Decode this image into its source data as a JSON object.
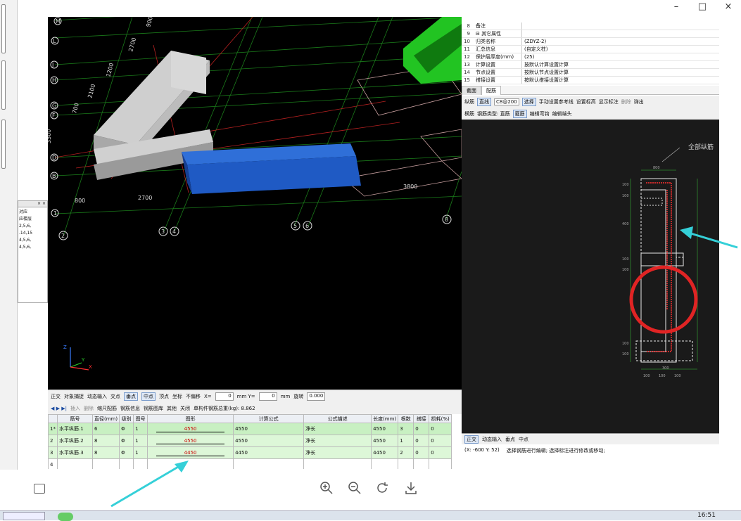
{
  "window": {
    "minimize": "–",
    "maximize": "□",
    "close": "×"
  },
  "leftPane": {
    "header": "× ×",
    "items": [
      "对应",
      "应楼层",
      "2,5,6,",
      ".14,15",
      "4,5,6,",
      "4,5,6,"
    ]
  },
  "viewport": {
    "axisLetters": [
      "M",
      "L",
      "K",
      "J",
      "H",
      "G",
      "F",
      "E",
      "D",
      "B"
    ],
    "axisNumbers": [
      "1",
      "2",
      "3",
      "4",
      "5",
      "6",
      "8"
    ],
    "dims": [
      "900",
      "2700",
      "1200",
      "2100",
      "700",
      "3500",
      "800",
      "2700",
      "3800",
      "6600"
    ],
    "triad": {
      "x": "X",
      "y": "Y",
      "z": "Z"
    }
  },
  "toolbar1": [
    "正交",
    "对象捕捉",
    "动态输入",
    "交点",
    "垂点",
    "中点",
    "顶点",
    "坐标",
    "不偏移",
    "X=",
    "mm Y=",
    "mm",
    "旋转"
  ],
  "toolbar1Values": {
    "x": "0",
    "y": "0",
    "rot": "0.000"
  },
  "toolbar2": [
    "插入",
    "删除",
    "缩尺配筋",
    "钢筋信息",
    "钢筋图库",
    "其他",
    "关闭",
    "单构件钢筋总重(kg): 8.862"
  ],
  "grid": {
    "headers": [
      "",
      "筋号",
      "直径(mm)",
      "级别",
      "图号",
      "图形",
      "计算公式",
      "公式描述",
      "长度(mm)",
      "根数",
      "搭接",
      "损耗(%)"
    ],
    "rows": [
      {
        "n": "1*",
        "name": "水平纵筋.1",
        "d": "6",
        "lv": "Φ",
        "fig": "1",
        "shape": "4550",
        "formula": "4550",
        "desc": "净长",
        "len": "4550",
        "cnt": "3",
        "lap": "0",
        "loss": "0"
      },
      {
        "n": "2",
        "name": "水平纵筋.2",
        "d": "8",
        "lv": "Φ",
        "fig": "1",
        "shape": "4550",
        "formula": "4550",
        "desc": "净长",
        "len": "4550",
        "cnt": "1",
        "lap": "0",
        "loss": "0"
      },
      {
        "n": "3",
        "name": "水平纵筋.3",
        "d": "8",
        "lv": "Φ",
        "fig": "1",
        "shape": "4450",
        "formula": "4450",
        "desc": "净长",
        "len": "4450",
        "cnt": "2",
        "lap": "0",
        "loss": "0"
      },
      {
        "n": "4",
        "name": "",
        "d": "",
        "lv": "",
        "fig": "",
        "shape": "",
        "formula": "",
        "desc": "",
        "len": "",
        "cnt": "",
        "lap": "",
        "loss": ""
      }
    ]
  },
  "props": [
    {
      "n": "8",
      "k": "备注",
      "v": ""
    },
    {
      "n": "9",
      "k": "⊟ 其它属性",
      "v": ""
    },
    {
      "n": "10",
      "k": "归类名称",
      "v": "(ZDYZ-2)"
    },
    {
      "n": "11",
      "k": "汇总信息",
      "v": "(自定义柱)"
    },
    {
      "n": "12",
      "k": "保护层厚度(mm)",
      "v": "(25)"
    },
    {
      "n": "13",
      "k": "计算设置",
      "v": "按默认计算设置计算"
    },
    {
      "n": "14",
      "k": "节点设置",
      "v": "按默认节点设置计算"
    },
    {
      "n": "15",
      "k": "搭接设置",
      "v": "按默认搭接设置计算"
    }
  ],
  "tabs": [
    "截面",
    "配筋"
  ],
  "ctl1": [
    "纵筋",
    "直线",
    "C8@200",
    "选择",
    "手动设置参考线",
    "设置标高",
    "显示标注",
    "删除",
    "弹出"
  ],
  "ctl2": [
    "横筋",
    "钢筋类型: 直筋",
    "箍筋",
    "编辑弯钩",
    "编辑端头"
  ],
  "drawing": {
    "label": "全部纵筋",
    "dims": [
      "800",
      "100",
      "100",
      "400",
      "100",
      "100",
      "100",
      "100",
      "800",
      "300",
      "100",
      "100",
      "100",
      "100"
    ]
  },
  "drwbar": [
    "正交",
    "动态输入",
    "垂点",
    "中点"
  ],
  "status": {
    "coords": "(X: -600 Y: 52)",
    "msg": "选择钢筋进行编辑; 选择标注进行修改或移动;"
  },
  "clock": "16:51"
}
